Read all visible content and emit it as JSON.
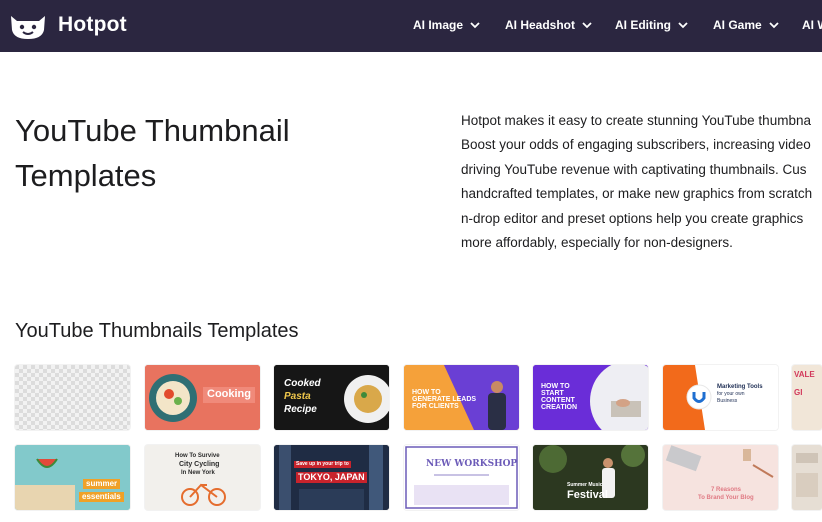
{
  "navbar": {
    "brand": "Hotpot",
    "items": [
      {
        "label": "AI Image"
      },
      {
        "label": "AI Headshot"
      },
      {
        "label": "AI Editing"
      },
      {
        "label": "AI Game"
      },
      {
        "label": "AI W"
      }
    ],
    "colors": {
      "background": "#2b2640",
      "text": "#ffffff"
    }
  },
  "hero": {
    "title_line1": "YouTube Thumbnail",
    "title_line2": "Templates",
    "description_lines": [
      "Hotpot makes it easy to create stunning YouTube thumbna",
      "Boost your odds of engaging subscribers, increasing video",
      "driving YouTube revenue with captivating thumbnails. Cus",
      "handcrafted templates, or make new graphics from scratch",
      "n-drop editor and preset options help you create graphics",
      "more affordably, especially for non-designers."
    ]
  },
  "templates": {
    "section_title": "YouTube Thumbnails Templates",
    "row1": [
      {
        "name": "blank"
      },
      {
        "text": "Cooking"
      },
      {
        "text_line1": "Cooked",
        "text_line2": "Pasta",
        "text_line3": "Recipe"
      },
      {
        "text_line1": "HOW TO",
        "text_line2": "GENERATE LEADS",
        "text_line3": "FOR CLIENTS"
      },
      {
        "text_line1": "HOW TO",
        "text_line2": "START",
        "text_line3": "CONTENT",
        "text_line4": "CREATION"
      },
      {
        "text_line1": "Marketing Tools",
        "text_line2": "for your own",
        "text_line3": "Business"
      },
      {
        "text_line1": "VALE",
        "text_line2": "GI"
      }
    ],
    "row2": [
      {
        "text_line1": "summer",
        "text_line2": "essentials"
      },
      {
        "text_line1": "How To Survive",
        "text_line2": "City Cycling",
        "text_line3": "In New York"
      },
      {
        "text_line1": "Save up in your trip to",
        "text_line2": "TOKYO, JAPAN"
      },
      {
        "text_line1": "NEW WORKSHOP"
      },
      {
        "text_line1": "Summer Music",
        "text_line2": "Festival"
      },
      {
        "text_line1": "7 Reasons",
        "text_line2": "To Brand Your Blog"
      },
      {
        "name": "partial-tile"
      }
    ]
  }
}
